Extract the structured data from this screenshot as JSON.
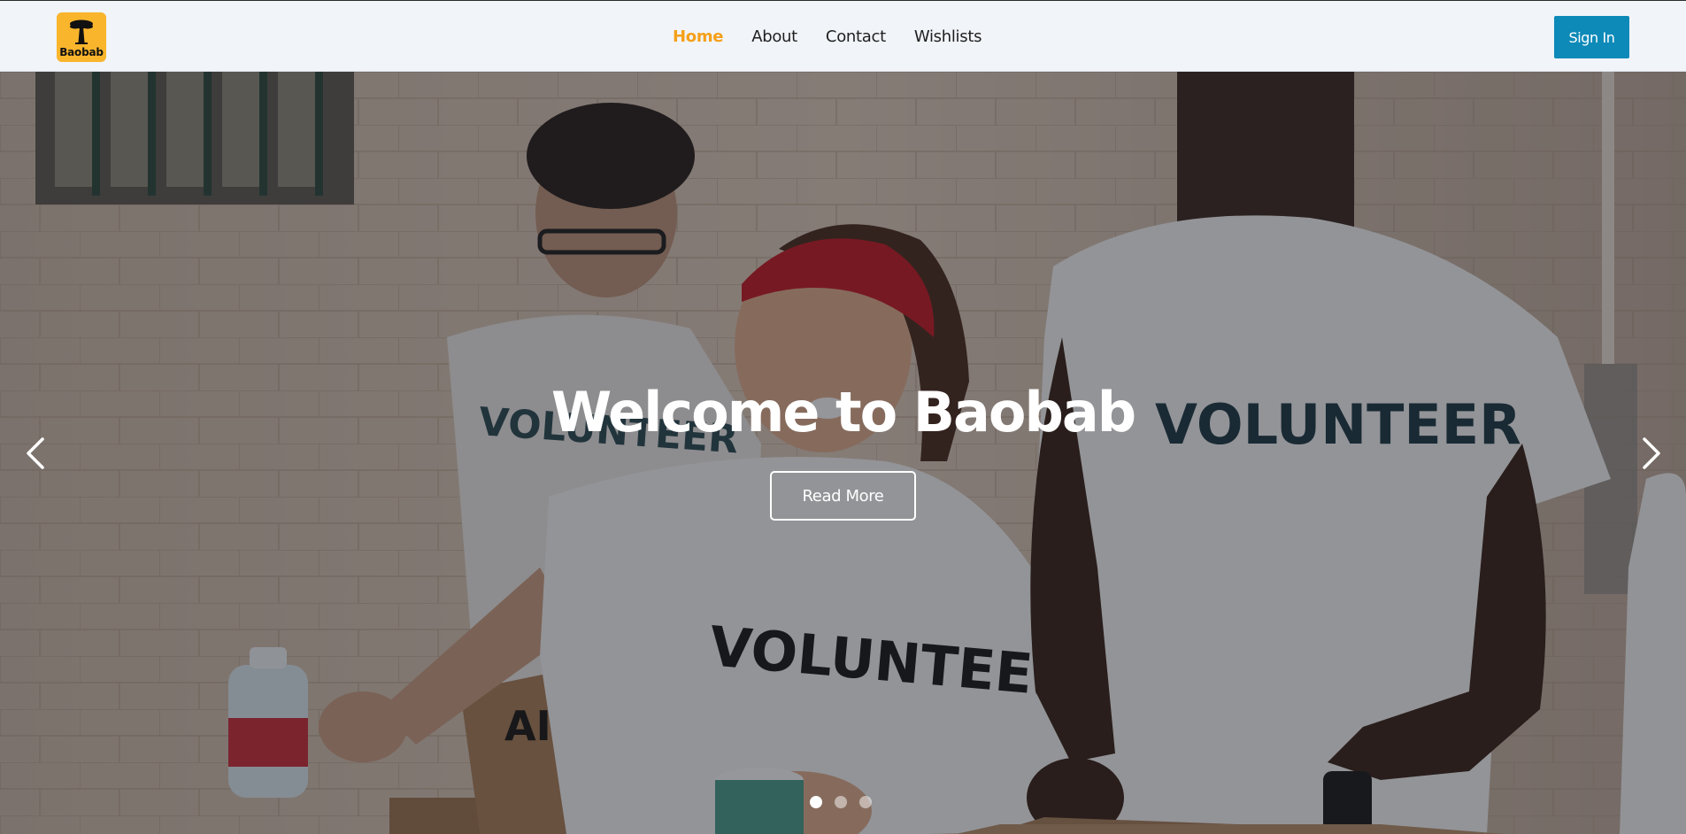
{
  "header": {
    "logo_text": "Baobab",
    "nav": [
      {
        "label": "Home",
        "active": true
      },
      {
        "label": "About",
        "active": false
      },
      {
        "label": "Contact",
        "active": false
      },
      {
        "label": "Wishlists",
        "active": false
      }
    ],
    "signin_label": "Sign In"
  },
  "hero": {
    "title": "Welcome to Baobab",
    "button_label": "Read More",
    "slides_count": 3,
    "active_slide": 1,
    "photo_text": {
      "shirt_label": "VOLUNTEER",
      "box_label": "AID"
    }
  },
  "colors": {
    "nav_active": "#f5a019",
    "signin_bg": "#0d8ab8",
    "logo_bg": "#f9b52c",
    "header_bg": "#f1f4f9"
  },
  "icons": {
    "prev": "chevron-left-icon",
    "next": "chevron-right-icon",
    "logo": "baobab-tree-icon"
  }
}
